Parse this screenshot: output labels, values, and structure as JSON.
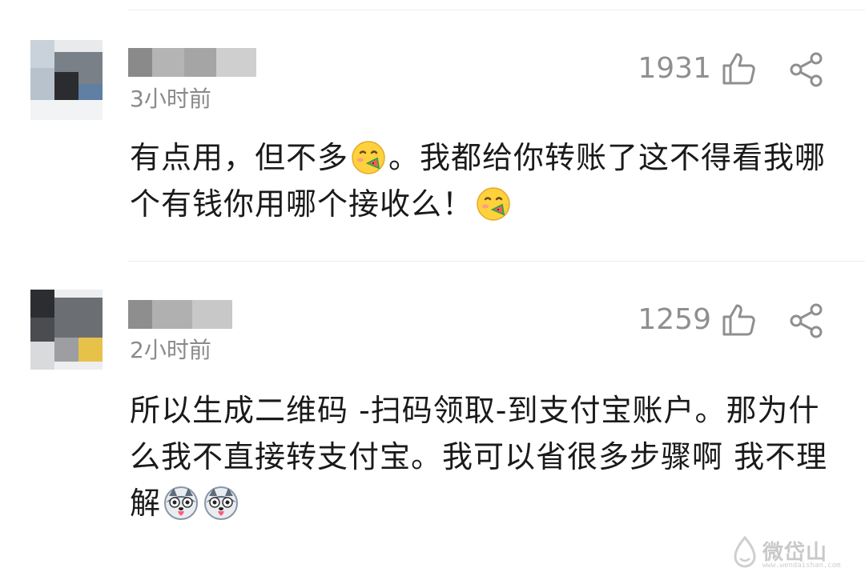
{
  "comments": [
    {
      "time": "3小时前",
      "likes": "1931",
      "text_before_emoji": "有点用，但不多",
      "text_after_emoji": "。我都给你转账了这不得看我哪个有钱你用哪个接收么！",
      "emoji": "yummy-face"
    },
    {
      "time": "2小时前",
      "likes": "1259",
      "text": "所以生成二维码 -扫码领取-到支付宝账户。那为什么我不直接转支付宝。我可以省很多步骤啊 我不理解",
      "emoji": "husky-dog"
    }
  ],
  "icons": {
    "like": "thumbs-up-icon",
    "share": "share-icon"
  },
  "watermark": {
    "text": "微岱山",
    "url": "www.wendaishan.com"
  },
  "colors": {
    "text": "#1a1a1a",
    "meta": "#8a8a8a",
    "divider": "#ececec"
  }
}
